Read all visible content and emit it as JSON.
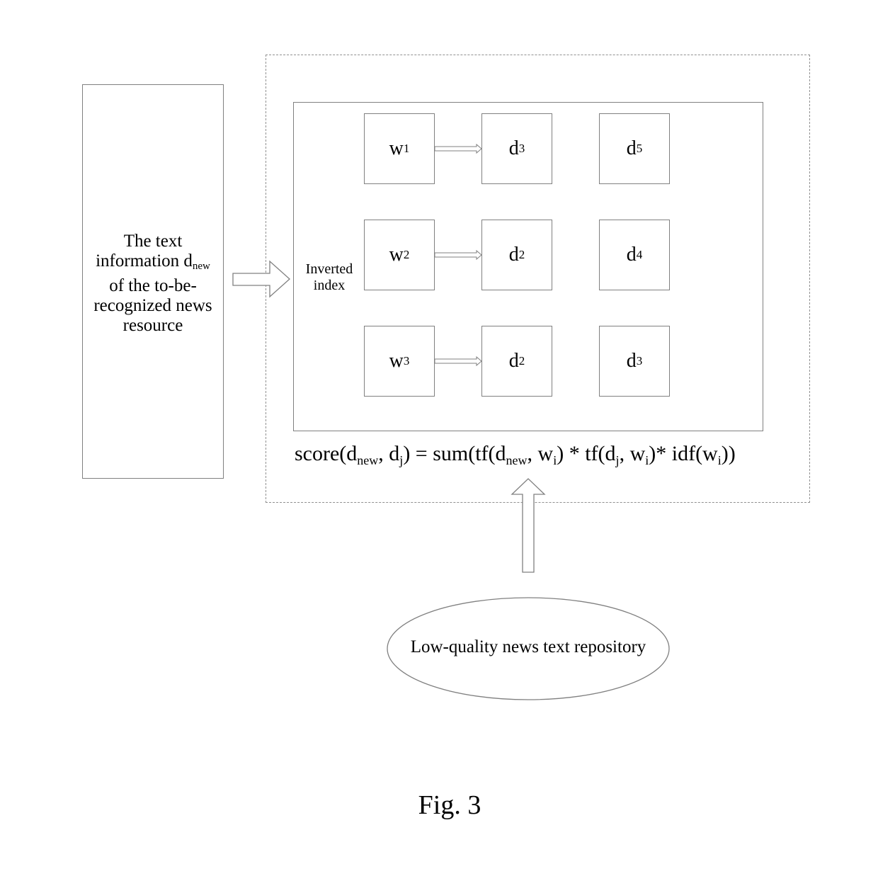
{
  "input_box": {
    "lines": [
      "The text",
      "information d",
      "of the to-be-",
      "recognized news",
      "resource"
    ],
    "subscript": "new"
  },
  "inverted_index": {
    "label_line1": "Inverted",
    "label_line2": "index",
    "rows": [
      {
        "term": "w",
        "term_sub": "1",
        "postings": [
          {
            "d": "d",
            "sub": "3"
          },
          {
            "d": "d",
            "sub": "5"
          }
        ]
      },
      {
        "term": "w",
        "term_sub": "2",
        "postings": [
          {
            "d": "d",
            "sub": "2"
          },
          {
            "d": "d",
            "sub": "4"
          }
        ]
      },
      {
        "term": "w",
        "term_sub": "3",
        "postings": [
          {
            "d": "d",
            "sub": "2"
          },
          {
            "d": "d",
            "sub": "3"
          }
        ]
      }
    ]
  },
  "formula": {
    "p1": "score(d",
    "s1": "new",
    "p2": ", d",
    "s2": "j",
    "p3": ") = sum(tf(d",
    "s3": "new",
    "p4": ", w",
    "s4": "i",
    "p5": ") * tf(d",
    "s5": "j",
    "p6": ", w",
    "s6": "i",
    "p7": ")* idf(w",
    "s7": "i",
    "p8": "))"
  },
  "repository": {
    "label": "Low-quality news text repository"
  },
  "caption": "Fig. 3"
}
